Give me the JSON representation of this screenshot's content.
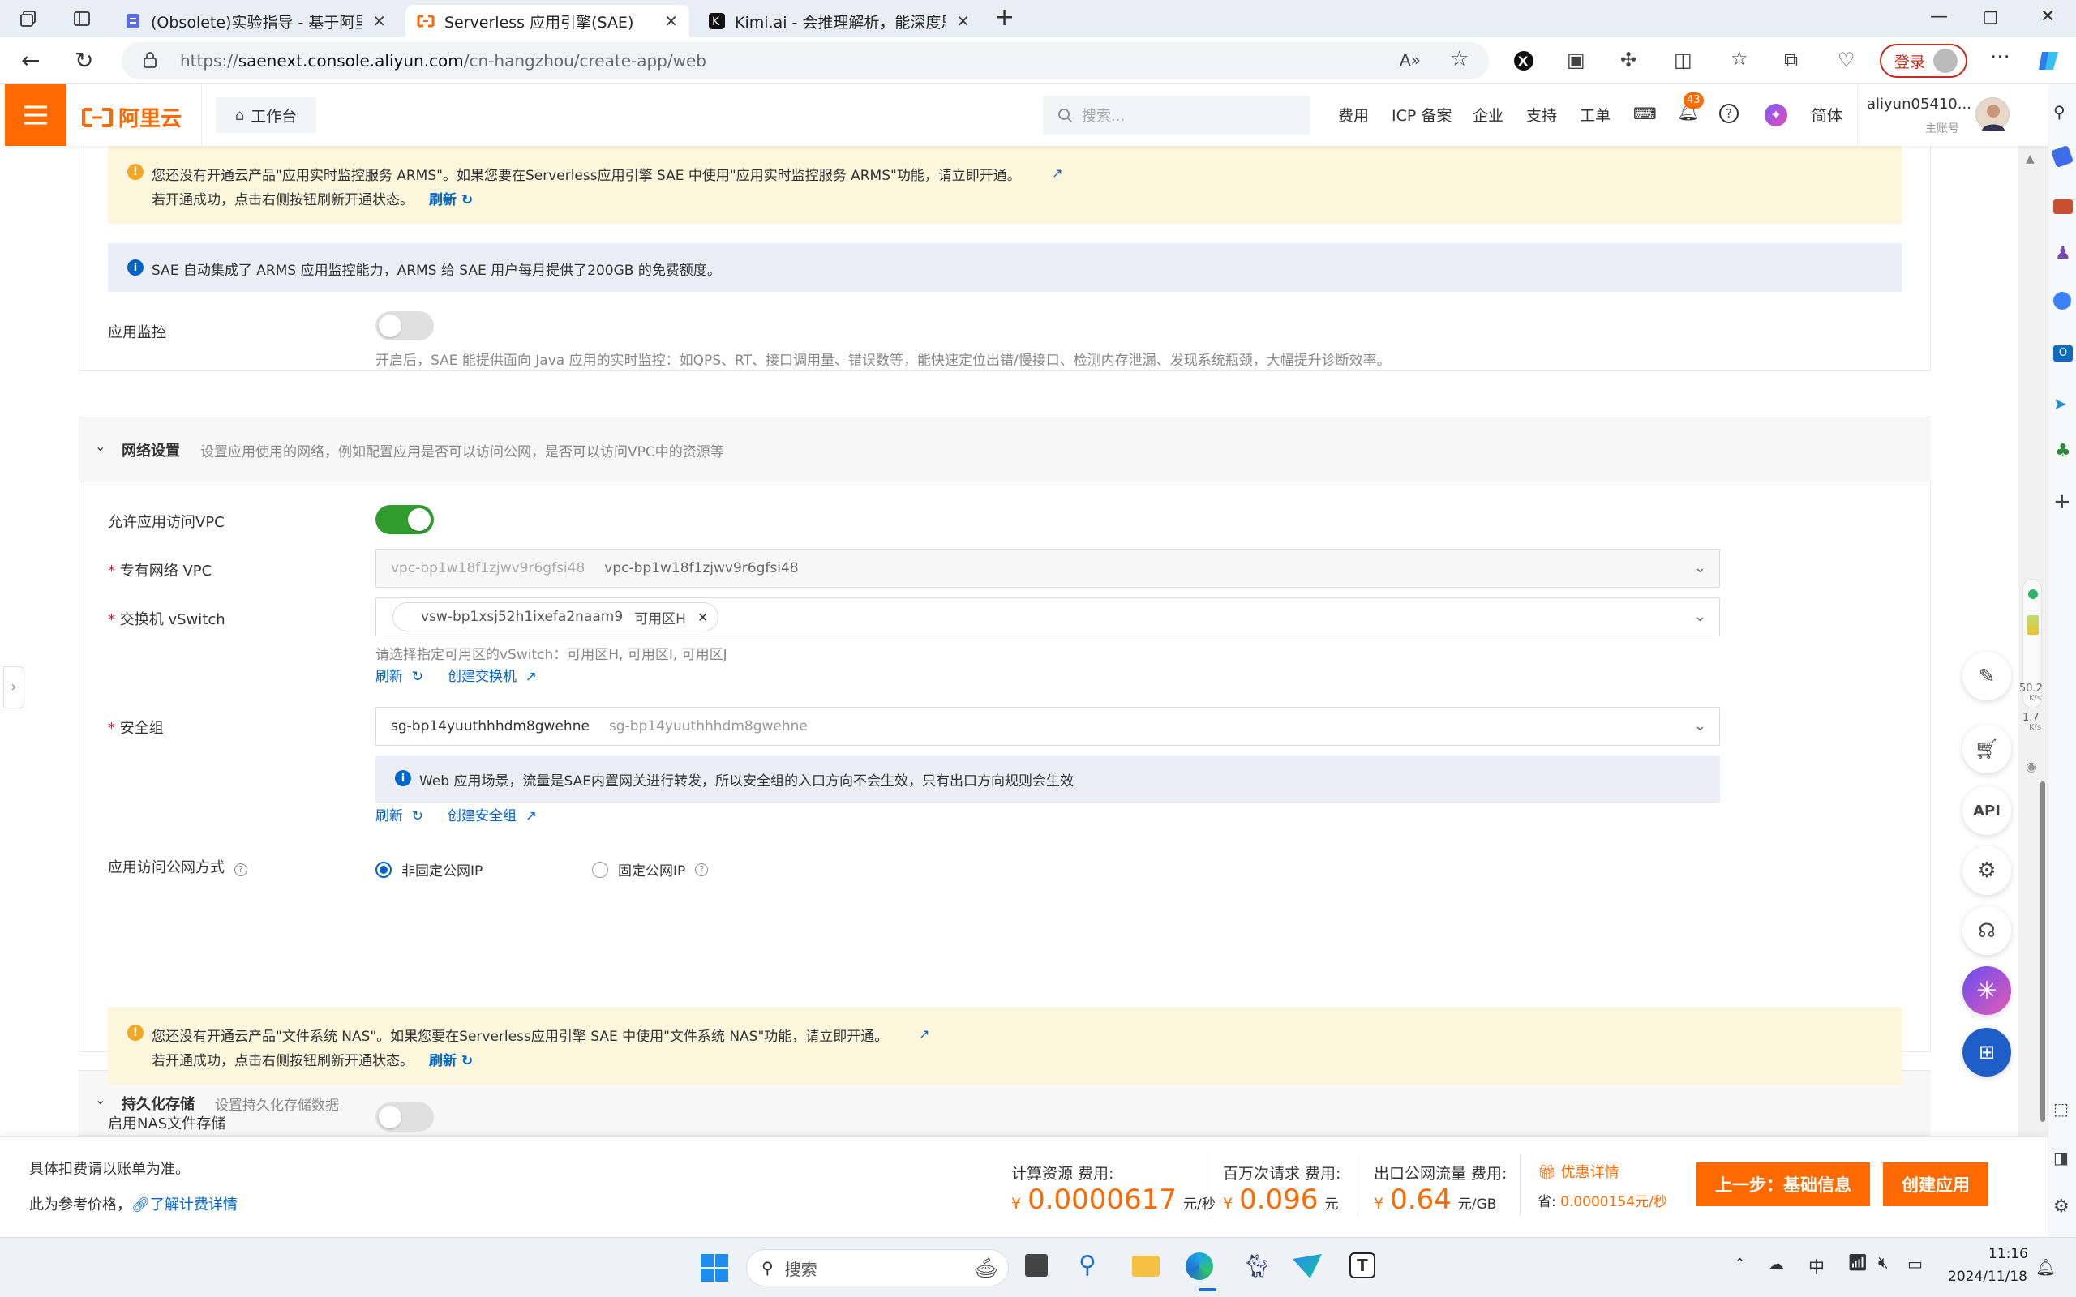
{
  "browser": {
    "tabs": [
      {
        "title": "(Obsolete)实验指导 - 基于阿里云"
      },
      {
        "title": "Serverless 应用引擎(SAE)"
      },
      {
        "title": "Kimi.ai - 会推理解析，能深度思考"
      }
    ],
    "url_prefix": "https://",
    "url_host": "saenext.console.aliyun.com",
    "url_path": "/cn-hangzhou/create-app/web",
    "login_label": "登录"
  },
  "header": {
    "logo_text": "阿里云",
    "workbench": "工作台",
    "search_placeholder": "搜索...",
    "nav": [
      "费用",
      "ICP 备案",
      "企业",
      "支持",
      "工单"
    ],
    "notification_count": "43",
    "lang": "简体",
    "user_name": "aliyun05410...",
    "user_role": "主账号"
  },
  "arms": {
    "warn_line1": "您还没有开通云产品\"应用实时监控服务 ARMS\"。如果您要在Serverless应用引擎 SAE 中使用\"应用实时监控服务 ARMS\"功能，请立即开通。",
    "warn_line2": "若开通成功，点击右侧按钮刷新开通状态。",
    "refresh": "刷新",
    "info": "SAE 自动集成了 ARMS 应用监控能力，ARMS 给 SAE 用户每月提供了200GB 的免费额度。",
    "monitor_label": "应用监控",
    "monitor_enabled": false,
    "monitor_desc": "开启后，SAE 能提供面向 Java 应用的实时监控：如QPS、RT、接口调用量、错误数等，能快速定位出错/慢接口、检测内存泄漏、发现系统瓶颈，大幅提升诊断效率。"
  },
  "network": {
    "title": "网络设置",
    "desc": "设置应用使用的网络，例如配置应用是否可以访问公网，是否可以访问VPC中的资源等",
    "allow_vpc_label": "允许应用访问VPC",
    "allow_vpc_enabled": true,
    "vpc_label": "专有网络 VPC",
    "vpc_placeholder": "vpc-bp1w18f1zjwv9r6gfsi48",
    "vpc_value": "vpc-bp1w18f1zjwv9r6gfsi48",
    "vswitch_label": "交换机 vSwitch",
    "vswitch_tag": "vsw-bp1xsj52h1ixefa2naam9",
    "vswitch_zone": "可用区H",
    "vswitch_hint": "请选择指定可用区的vSwitch：可用区H, 可用区I, 可用区J",
    "refresh": "刷新",
    "create_vswitch": "创建交换机",
    "sg_label": "安全组",
    "sg_value": "sg-bp14yuuthhhdm8gwehne",
    "sg_secondary": "sg-bp14yuuthhhdm8gwehne",
    "sg_info": "Web 应用场景，流量是SAE内置网关进行转发，所以安全组的入口方向不会生效，只有出口方向规则会生效",
    "create_sg": "创建安全组",
    "public_label": "应用访问公网方式",
    "public_options": [
      "非固定公网IP",
      "固定公网IP"
    ],
    "public_selected": "非固定公网IP"
  },
  "storage": {
    "title": "持久化存储",
    "desc": "设置持久化存储数据",
    "warn_line1": "您还没有开通云产品\"文件系统 NAS\"。如果您要在Serverless应用引擎 SAE 中使用\"文件系统 NAS\"功能，请立即开通。",
    "warn_line2": "若开通成功，点击右侧按钮刷新开通状态。",
    "refresh": "刷新",
    "nas_label": "启用NAS文件存储",
    "nas_enabled": false
  },
  "footer": {
    "note1": "具体扣费请以账单为准。",
    "note2": "此为参考价格，",
    "pricing_link": "了解计费详情",
    "compute_label": "计算资源 费用:",
    "compute_value": "0.0000617",
    "compute_unit": "元/秒",
    "request_label": "百万次请求 费用:",
    "request_value": "0.096",
    "request_unit": "元",
    "traffic_label": "出口公网流量 费用:",
    "traffic_value": "0.64",
    "traffic_unit": "元/GB",
    "currency": "¥",
    "discount_label": "优惠详情",
    "save_label": "省:",
    "save_value": "0.0000154元/秒",
    "prev_button": "上一步：基础信息",
    "create_button": "创建应用"
  },
  "netspeed": {
    "up": "50.2",
    "up_unit": "K/s",
    "down": "1.7",
    "down_unit": "K/s"
  },
  "taskbar": {
    "search": "搜索",
    "ime": "中",
    "time": "11:16",
    "date": "2024/11/18"
  },
  "colors": {
    "brand": "#ff6a00",
    "link": "#0064c8",
    "toggle_on": "#2f9e2f",
    "warn_bg": "#fcf6dc",
    "info_bg": "#ebeef6"
  }
}
